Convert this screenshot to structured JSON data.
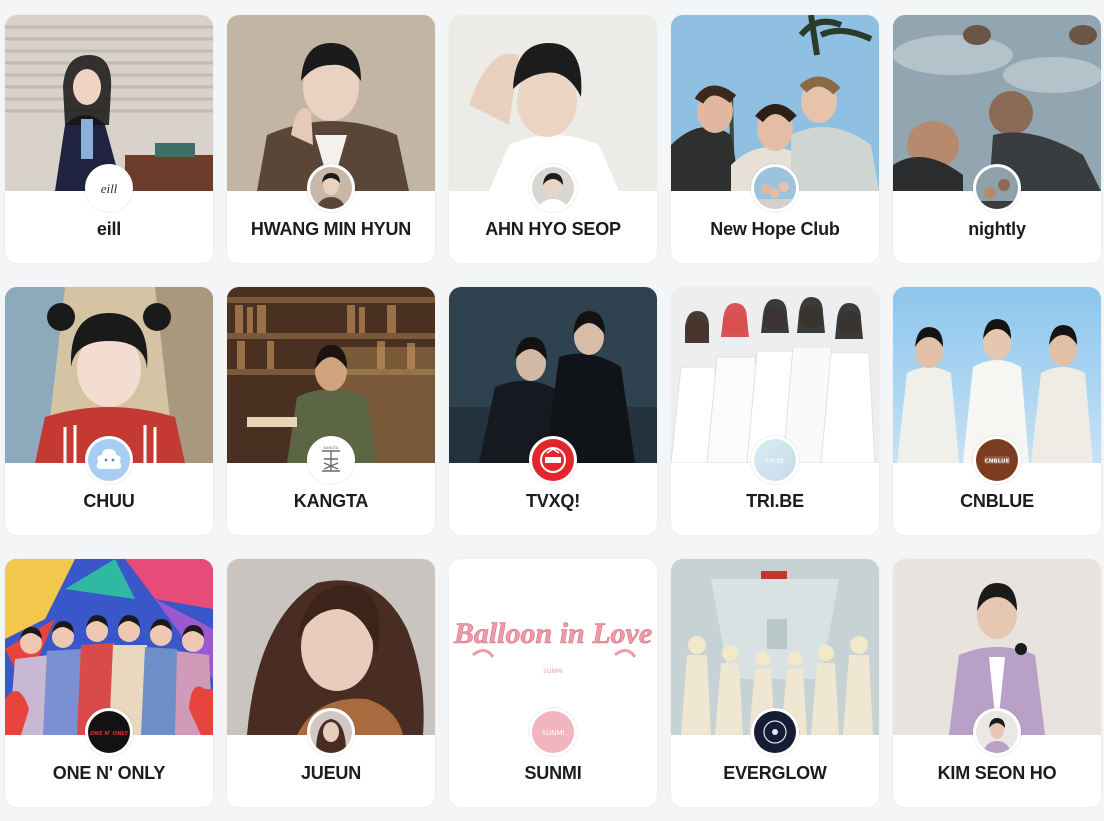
{
  "artists": [
    {
      "name": "eill",
      "avatar_text": "eill",
      "colors": {
        "cover": "#cfc8c0",
        "accent": "#1f2340",
        "avatar_bg": "#ffffff"
      }
    },
    {
      "name": "HWANG MIN HYUN",
      "avatar_text": "",
      "colors": {
        "cover": "#b8aa98",
        "accent": "#5a4636",
        "avatar_bg": "#c7b8a8"
      }
    },
    {
      "name": "AHN HYO SEOP",
      "avatar_text": "",
      "colors": {
        "cover": "#e9e7e4",
        "accent": "#2b2b2b",
        "avatar_bg": "#d9d6d2"
      }
    },
    {
      "name": "New Hope Club",
      "avatar_text": "",
      "colors": {
        "cover": "#86b8dc",
        "accent": "#3b3b3b",
        "avatar_bg": "#9cc3dd"
      }
    },
    {
      "name": "nightly",
      "avatar_text": "",
      "colors": {
        "cover": "#8a9ba4",
        "accent": "#2c2f31",
        "avatar_bg": "#8ea0a8"
      }
    },
    {
      "name": "CHUU",
      "avatar_text": "",
      "colors": {
        "cover": "#cbb89a",
        "accent": "#c43a33",
        "avatar_bg": "#a7cdf2"
      }
    },
    {
      "name": "KANGTA",
      "avatar_text": "KANGTA",
      "colors": {
        "cover": "#5b3d28",
        "accent": "#a98c6a",
        "avatar_bg": "#ffffff"
      }
    },
    {
      "name": "TVXQ!",
      "avatar_text": "",
      "colors": {
        "cover": "#2a3b48",
        "accent": "#151a20",
        "avatar_bg": "#e3262d"
      }
    },
    {
      "name": "TRI.BE",
      "avatar_text": "TRI.BE",
      "colors": {
        "cover": "#e9ecef",
        "accent": "#ffffff",
        "avatar_bg": "#cfe6ef"
      }
    },
    {
      "name": "CNBLUE",
      "avatar_text": "CNBLUE",
      "colors": {
        "cover": "#9fd0f1",
        "accent": "#f1efe9",
        "avatar_bg": "#7b3c1f"
      }
    },
    {
      "name": "ONE N' ONLY",
      "avatar_text": "ONE N' ONLY",
      "colors": {
        "cover": "#e64b7a",
        "accent": "#3a57c9",
        "avatar_bg": "#121212"
      }
    },
    {
      "name": "JUEUN",
      "avatar_text": "",
      "colors": {
        "cover": "#c4bfba",
        "accent": "#5b3a2b",
        "avatar_bg": "#d2c8c1"
      }
    },
    {
      "name": "SUNMI",
      "avatar_text": "SUNMI",
      "cover_text": "Balloon in Love",
      "cover_sub": "SUNMI",
      "colors": {
        "cover": "#ffffff",
        "accent": "#ee9aa8",
        "avatar_bg": "#f2b5bd"
      }
    },
    {
      "name": "EVERGLOW",
      "avatar_text": "",
      "colors": {
        "cover": "#c9d3d5",
        "accent": "#efe7d2",
        "avatar_bg": "#151c33"
      }
    },
    {
      "name": "KIM SEON HO",
      "avatar_text": "",
      "colors": {
        "cover": "#e7e2dd",
        "accent": "#b9a0c7",
        "avatar_bg": "#ebe7e4"
      }
    }
  ]
}
